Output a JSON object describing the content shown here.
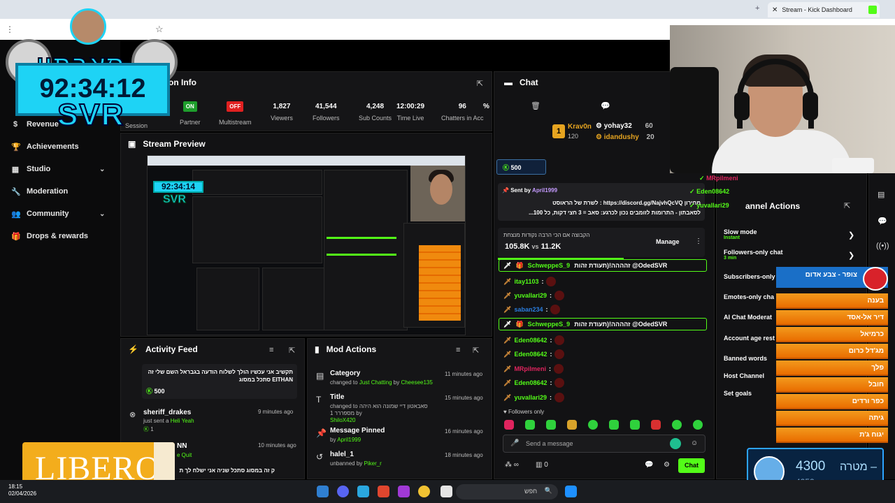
{
  "browser": {
    "tab_title": "Stream - Kick Dashboard",
    "close_icon": "x-icon",
    "new_tab": "+"
  },
  "sidebar": {
    "items": [
      {
        "label": "Revenue",
        "icon": "dollar-icon"
      },
      {
        "label": "Achievements",
        "icon": "trophy-icon"
      },
      {
        "label": "Studio",
        "icon": "studio-icon",
        "chevron": true
      },
      {
        "label": "Moderation",
        "icon": "wrench-icon"
      },
      {
        "label": "Community",
        "icon": "people-icon",
        "chevron": true
      },
      {
        "label": "Drops & rewards",
        "icon": "gift-icon"
      }
    ]
  },
  "session": {
    "title": "on Info",
    "session_label": "Session",
    "partner": {
      "badge": "ON",
      "label": "Partner"
    },
    "multistream": {
      "badge": "OFF",
      "label": "Multistream"
    },
    "stats": [
      {
        "value": "1,827",
        "label": "Viewers"
      },
      {
        "value": "41,544",
        "label": "Followers"
      },
      {
        "value": "4,248",
        "label": "Sub Counts"
      },
      {
        "value": "12:00:29",
        "label": "Time Live"
      },
      {
        "value": "96",
        "label": "Chatters in Acc"
      },
      {
        "value": "%",
        "label": ""
      }
    ]
  },
  "preview": {
    "title": "Stream Preview",
    "timer": "92:34:14",
    "svr": "SVR"
  },
  "activity": {
    "title": "Activity Feed",
    "items": [
      {
        "text": "תקשיב אני עכשיו הולך לשלוח הודעה בגבראל השם שלי זה EITHAN סתכל במסוג",
        "points": "500"
      },
      {
        "user": "sheriff_drakes",
        "action": "just sent a",
        "reward": "Heli Yeah",
        "time": "9 minutes ago",
        "points": "1"
      },
      {
        "user": "NN",
        "reward": "e Quit",
        "time": "10 minutes ago"
      },
      {
        "text": "ק זה במסוג סתכל שניה אני ישלח לך ת"
      }
    ]
  },
  "mod_actions": {
    "title": "Mod Actions",
    "items": [
      {
        "title": "Category",
        "line": "changed to",
        "target": "Just Chatting",
        "by": "by",
        "user": "Cheesee135",
        "time": "11 minutes ago",
        "icon": "category-icon"
      },
      {
        "title": "Title",
        "line": "changed to",
        "target": "סאבאטון דיי שמונה הוא היהה מספררר 1",
        "by": "by",
        "user": "ShiloX420",
        "time": "15 minutes ago",
        "icon": "title-icon"
      },
      {
        "title": "Message Pinned",
        "line": "by",
        "target": "",
        "by": "",
        "user": "April1999",
        "time": "16 minutes ago",
        "icon": "pin-icon"
      },
      {
        "title": "halel_1",
        "line": "unbanned by",
        "target": "",
        "by": "",
        "user": "Piker_r",
        "time": "18 minutes ago",
        "icon": "undo-icon"
      }
    ]
  },
  "chat": {
    "title": "Chat",
    "top_gifters": [
      {
        "rank": "1",
        "user": "Krav0n",
        "count": "120"
      },
      {
        "user": "yohay32",
        "count": "60"
      },
      {
        "user": "idandushy",
        "count": "20"
      }
    ],
    "kick_points": "500",
    "pinned": {
      "sent_by_label": "Sent by",
      "sent_by": "April1999",
      "line1": "מחירון https://discord.gg/NajvhQcVQ : לשרת של הראוסט",
      "line2": "לסאבתון - התרומות לזומבים נכון לכרגע: סאב = 3 חצי דקות, כל 100..."
    },
    "poll": {
      "text": "הקבוצה אם הכי הרבה נקודות מנצחת",
      "left": "105.8K",
      "vs": "vs",
      "right": "11.2K",
      "manage": "Manage"
    },
    "messages": [
      {
        "type": "sub",
        "user": "SchweppeS_9",
        "text": "זהההה!(תעודת זהות @OdedSVR"
      },
      {
        "user": "itay1103",
        "color": "#53fc18"
      },
      {
        "user": "yuvallari29",
        "color": "#53fc18"
      },
      {
        "user": "saban234",
        "color": "#2a7dde"
      },
      {
        "type": "sub",
        "user": "SchweppeS_9",
        "text": "זהההה!(תעודת זהות @OdedSVR"
      },
      {
        "user": "Eden08642",
        "color": "#53fc18"
      },
      {
        "user": "Eden08642",
        "color": "#53fc18"
      },
      {
        "user": "MRpilmeni",
        "color": "#e0245e"
      },
      {
        "user": "Eden08642",
        "color": "#53fc18"
      },
      {
        "user": "yuvallari29",
        "color": "#53fc18"
      }
    ],
    "followers_only": "Followers only",
    "input_placeholder": "Send a message",
    "viewers_count": "0",
    "chat_button": "Chat"
  },
  "channel_actions": {
    "title": "annel Actions",
    "overlay_users": [
      "MRpilmeni",
      "Eden08642",
      "yuvallari29"
    ],
    "items": [
      {
        "label": "Slow mode",
        "sub": "Instant",
        "chevron": true
      },
      {
        "label": "Followers-only chat",
        "sub": "3 min",
        "chevron": true
      },
      {
        "label": "Subscribers-only"
      },
      {
        "label": "Emotes-only cha"
      },
      {
        "label": "AI Chat Moderat"
      },
      {
        "label": "Account age rest"
      },
      {
        "label": "Banned words"
      },
      {
        "label": "Host Channel"
      },
      {
        "label": "Set goals"
      }
    ]
  },
  "leaderboard": {
    "header": "צופר - צבע אדום",
    "rows": [
      "בענה",
      "דיר אל-אסד",
      "כרמיאל",
      "מג'דל כרום",
      "פלך",
      "חובל",
      "כפר ורדים",
      "גיתה",
      "יגוח ג'ת"
    ]
  },
  "goal": {
    "label": "מטרה",
    "target": "4300",
    "current": "4252"
  },
  "overlay": {
    "logo": "סאבתון",
    "timer": "92:34:12",
    "svr": "SVR",
    "sponsor": "LIBERO"
  },
  "taskbar": {
    "search": "חפש",
    "time": "18:15",
    "date": "02/04/2026"
  },
  "colors": {
    "accent": "#53fc18",
    "overlay_cyan": "#1ed3f5",
    "leaderboard_orange": "#f39a1d"
  }
}
